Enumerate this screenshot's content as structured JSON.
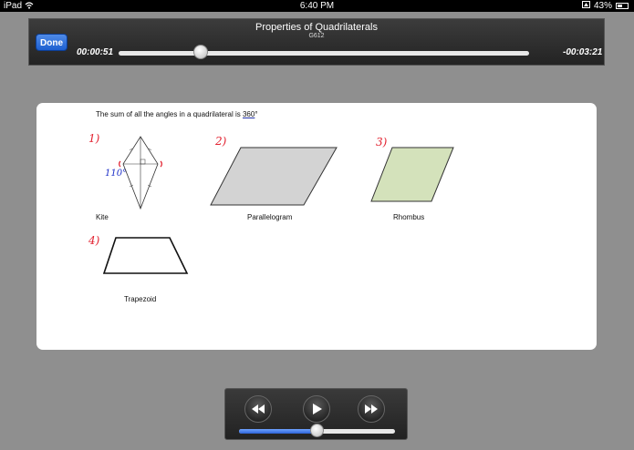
{
  "status_bar": {
    "device": "iPad",
    "time": "6:40 PM",
    "battery": "43%",
    "icons": [
      "wifi-icon",
      "orientation-lock-icon",
      "battery-icon"
    ]
  },
  "player": {
    "done_label": "Done",
    "title": "Properties of Quadrilaterals",
    "subtitle": "G612",
    "elapsed": "00:00:51",
    "remaining": "-00:03:21",
    "progress": 0.2
  },
  "slide": {
    "heading_prefix": "The sum of all the angles in a quadrilateral is ",
    "heading_value": "360",
    "heading_suffix": "°",
    "shapes": [
      {
        "number": "1)",
        "label": "Kite",
        "annotation": "110°"
      },
      {
        "number": "2)",
        "label": "Parallelogram"
      },
      {
        "number": "3)",
        "label": "Rhombus"
      },
      {
        "number": "4)",
        "label": "Trapezoid"
      }
    ],
    "colors": {
      "parallelogram_fill": "#d3d3d3",
      "rhombus_fill": "#d4e2bb",
      "handwriting_red": "#e2202e",
      "handwriting_blue": "#1d2fc8"
    }
  },
  "controls": {
    "icons": [
      "rewind-icon",
      "play-icon",
      "fast-forward-icon"
    ],
    "volume": 0.5
  }
}
